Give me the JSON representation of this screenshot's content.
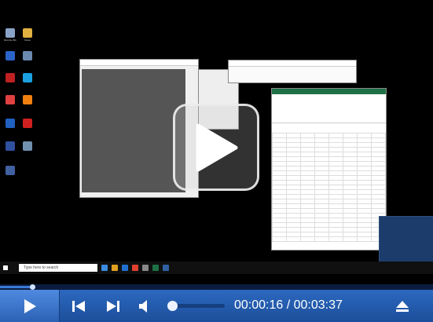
{
  "desktop": {
    "icons": [
      {
        "label": "Recycle Bin",
        "color": "#8aa4c8"
      },
      {
        "label": "Notes",
        "color": "#e0b040"
      },
      {
        "label": "",
        "color": "#2a64c8"
      },
      {
        "label": "",
        "color": "#6a8ab0"
      },
      {
        "label": "",
        "color": "#c02020"
      },
      {
        "label": "",
        "color": "#1aa0e0"
      },
      {
        "label": "",
        "color": "#e04040"
      },
      {
        "label": "",
        "color": "#f08010"
      },
      {
        "label": "",
        "color": "#2060c0"
      },
      {
        "label": "",
        "color": "#d02020"
      },
      {
        "label": "",
        "color": "#3050a0"
      },
      {
        "label": "",
        "color": "#7090b0"
      },
      {
        "label": "",
        "color": "#4060a0"
      }
    ]
  },
  "image_window": {
    "title": ""
  },
  "excel_window": {
    "title": ""
  },
  "taskbar": {
    "search_placeholder": "Type here to search"
  },
  "player": {
    "time_current": "00:00:16",
    "time_total": "00:03:37",
    "time_separator": " / ",
    "progress": 0.074,
    "volume": 0.07,
    "accent_color": "#2c69c0"
  }
}
